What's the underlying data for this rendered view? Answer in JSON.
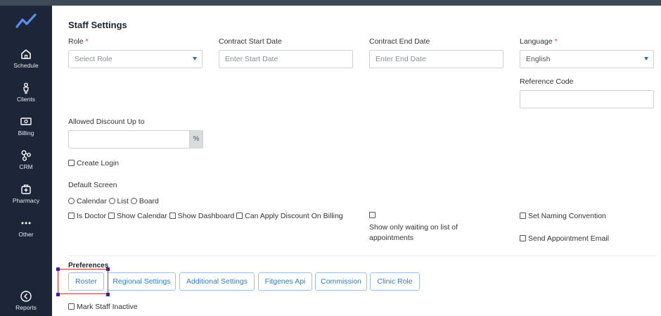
{
  "sidebar": {
    "items": [
      {
        "label": "Schedule",
        "icon": "home-icon"
      },
      {
        "label": "Clients",
        "icon": "person-icon"
      },
      {
        "label": "Billing",
        "icon": "money-icon"
      },
      {
        "label": "CRM",
        "icon": "crm-icon"
      },
      {
        "label": "Pharmacy",
        "icon": "medical-bag-icon"
      },
      {
        "label": "Other",
        "icon": "more-dots-icon"
      }
    ],
    "reports": {
      "label": "Reports",
      "icon": "back-circle-icon"
    }
  },
  "page": {
    "title": "Staff Settings"
  },
  "form": {
    "role": {
      "label": "Role",
      "required": "*",
      "placeholder": "Select Role"
    },
    "contract_start": {
      "label": "Contract Start Date",
      "placeholder": "Enter Start Date"
    },
    "contract_end": {
      "label": "Contract End Date",
      "placeholder": "Enter End Date"
    },
    "language": {
      "label": "Language",
      "required": "*",
      "value": "English"
    },
    "reference_code": {
      "label": "Reference Code",
      "value": ""
    },
    "allowed_discount": {
      "label": "Allowed Discount Up to",
      "value": "",
      "suffix": "%"
    },
    "create_login": {
      "label": "Create Login",
      "checked": false
    },
    "default_screen": {
      "label": "Default Screen",
      "options": [
        "Calendar",
        "List",
        "Board"
      ]
    },
    "checkboxes": {
      "is_doctor": "Is Doctor",
      "show_calendar": "Show Calendar",
      "show_dashboard": "Show Dashboard",
      "can_apply_discount": "Can Apply Discount On Billing",
      "show_only_waiting_line1": "Show only waiting on list of",
      "show_only_waiting_line2": "appointments",
      "set_naming_convention": "Set Naming Convention",
      "send_appointment_email": "Send Appointment Email"
    }
  },
  "preferences": {
    "label": "Preferences",
    "buttons": [
      "Roster",
      "Regional Settings",
      "Additional Settings",
      "Fitgenes Api",
      "Commission",
      "Clinic Role"
    ],
    "mark_inactive": "Mark Staff Inactive"
  },
  "colors": {
    "sidebar": "#1c2638",
    "accent": "#2f7ec6",
    "highlight": "#e0262b",
    "logo": "#5b8def"
  }
}
